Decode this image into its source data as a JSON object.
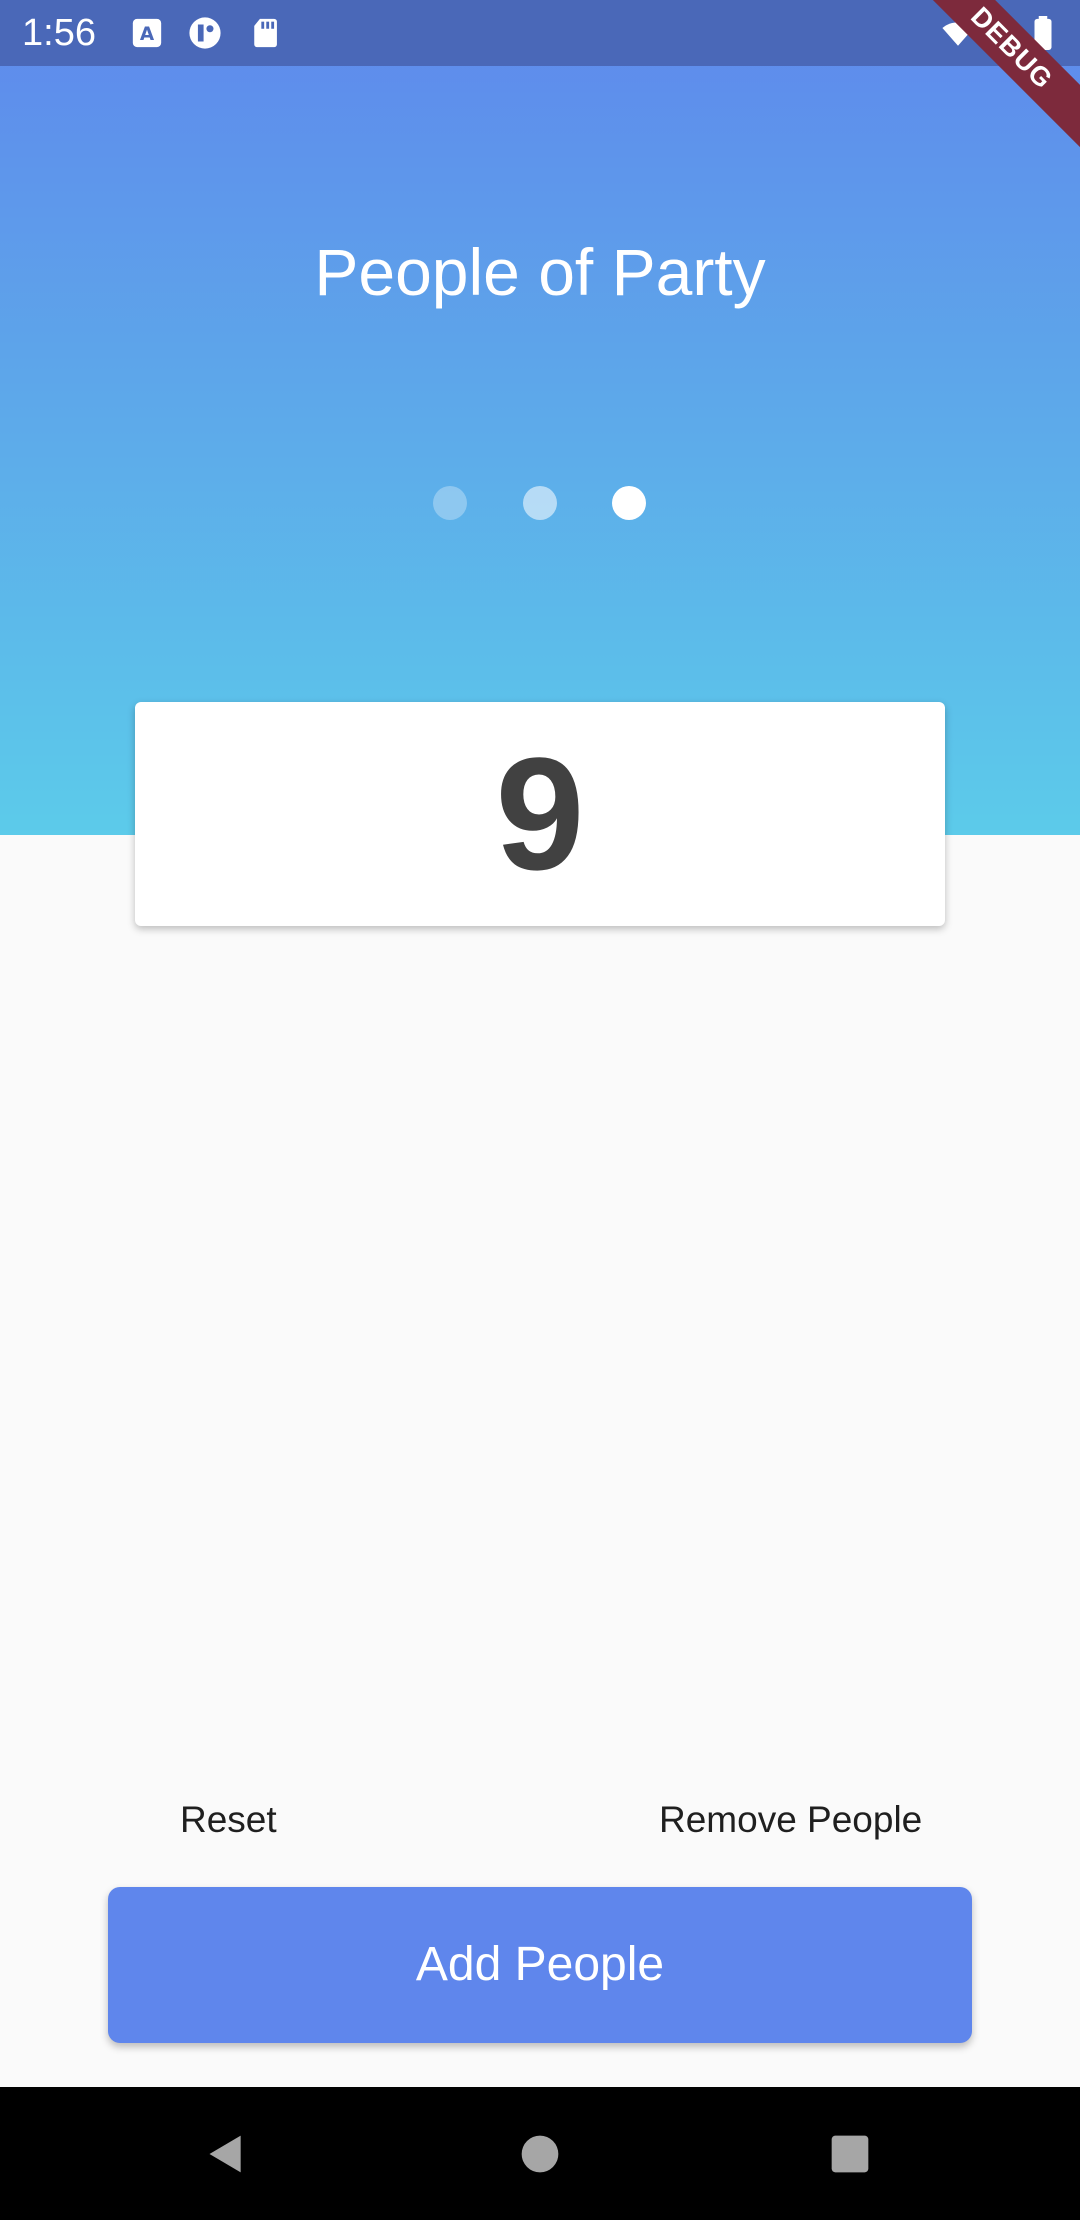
{
  "status_bar": {
    "time": "1:56",
    "icons": [
      "text-a-icon",
      "app-circle-icon",
      "sd-card-icon",
      "wifi-icon",
      "cellular-icon",
      "battery-icon"
    ]
  },
  "debug_banner": {
    "label": "DEBUG"
  },
  "header": {
    "title": "People of Party",
    "page_indicator": {
      "count": 3,
      "active_index": 2
    }
  },
  "counter": {
    "value": "9"
  },
  "actions": {
    "reset_label": "Reset",
    "remove_label": "Remove People",
    "add_label": "Add People"
  },
  "navigation_bar": {
    "icons": [
      "back-icon",
      "home-icon",
      "recents-icon"
    ]
  },
  "colors": {
    "gradient_top": "#5f88ec",
    "gradient_bottom": "#5ccbea",
    "primary_button": "#5f86ec",
    "counter_text": "#414141",
    "background": "#fafafa"
  }
}
